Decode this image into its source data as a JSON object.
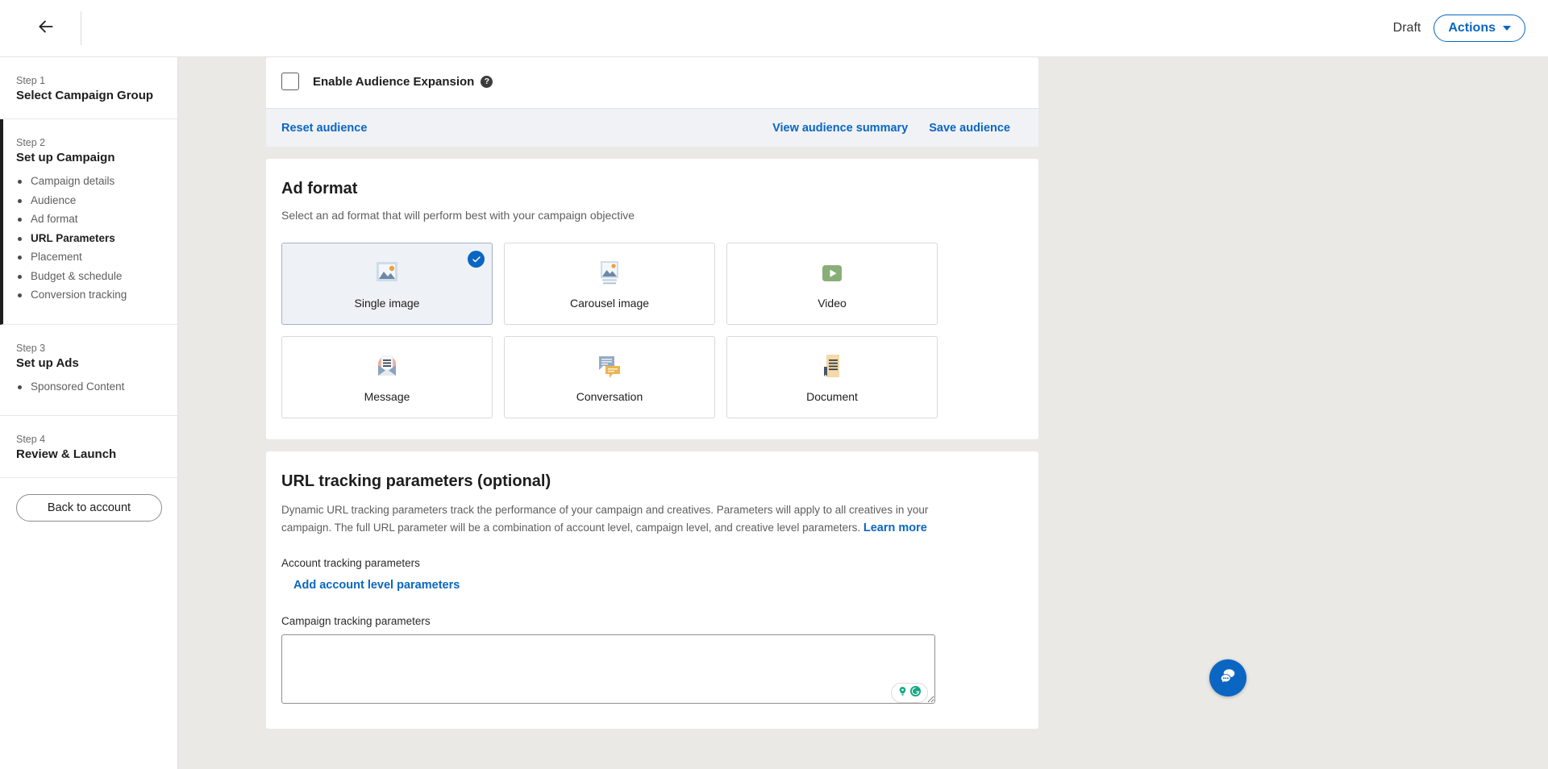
{
  "topbar": {
    "back_icon": "arrow-left-icon",
    "status_label": "Draft",
    "actions_label": "Actions",
    "caret_icon": "chevron-down-icon"
  },
  "sidebar": {
    "steps": [
      {
        "num": "Step 1",
        "title": "Select Campaign Group",
        "items": []
      },
      {
        "num": "Step 2",
        "title": "Set up Campaign",
        "items": [
          "Campaign details",
          "Audience",
          "Ad format",
          "URL Parameters",
          "Placement",
          "Budget & schedule",
          "Conversion tracking"
        ],
        "current_item": "URL Parameters"
      },
      {
        "num": "Step 3",
        "title": "Set up Ads",
        "items": [
          "Sponsored Content"
        ]
      },
      {
        "num": "Step 4",
        "title": "Review & Launch",
        "items": []
      }
    ],
    "back_to_account": "Back to account"
  },
  "audience": {
    "expansion_label": "Enable Audience Expansion",
    "expansion_checked": false,
    "help_icon": "question-mark-icon",
    "reset_label": "Reset audience",
    "view_summary_label": "View audience summary",
    "save_label": "Save audience"
  },
  "ad_format": {
    "title": "Ad format",
    "subtitle": "Select an ad format that will perform best with your campaign objective",
    "selected": "Single image",
    "check_icon": "check-circle-icon",
    "options": [
      {
        "label": "Single image",
        "icon": "single-image-icon",
        "selected": true
      },
      {
        "label": "Carousel image",
        "icon": "carousel-image-icon",
        "selected": false
      },
      {
        "label": "Video",
        "icon": "video-play-icon",
        "selected": false
      },
      {
        "label": "Message",
        "icon": "envelope-icon",
        "selected": false
      },
      {
        "label": "Conversation",
        "icon": "chat-bubbles-icon",
        "selected": false
      },
      {
        "label": "Document",
        "icon": "document-icon",
        "selected": false
      }
    ]
  },
  "url_tracking": {
    "title": "URL tracking parameters (optional)",
    "description": "Dynamic URL tracking parameters track the performance of your campaign and creatives. Parameters will apply to all creatives in your campaign. The full URL parameter will be a combination of account level, campaign level, and creative level parameters.",
    "learn_more": "Learn more",
    "account_label": "Account tracking parameters",
    "add_account_link": "Add account level parameters",
    "campaign_label": "Campaign tracking parameters",
    "campaign_value": "",
    "grammarly_icons": [
      "lightbulb-icon",
      "grammarly-g-icon"
    ]
  },
  "chat": {
    "icon": "chat-bubble-icon"
  },
  "colors": {
    "accent": "#0a66c2",
    "page_bg": "#ebe9e6",
    "actionbar_bg": "#f0f2f5",
    "selected_card_bg": "#eef1f6",
    "grammarly_green": "#15a886"
  }
}
